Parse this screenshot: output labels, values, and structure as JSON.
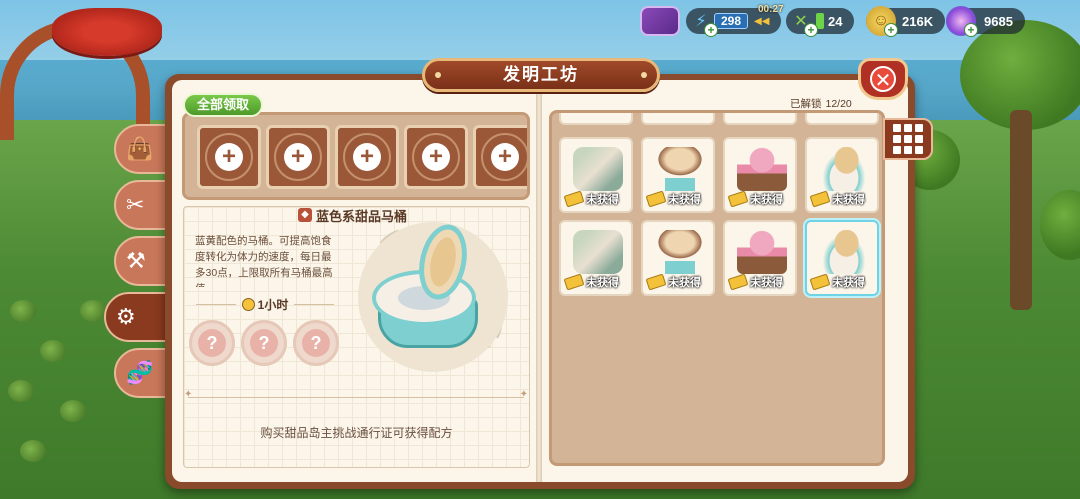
{
  "hud": {
    "energy": "298",
    "timer": "00:27",
    "food": "24",
    "coins": "216K",
    "gems": "9685"
  },
  "window": {
    "title": "发明工坊",
    "close_icon": "close-icon"
  },
  "side_tabs": [
    {
      "icon": "bag-icon"
    },
    {
      "icon": "fork-knife-icon"
    },
    {
      "icon": "anvil-icon"
    },
    {
      "icon": "gear-bulb-icon"
    },
    {
      "icon": "dna-icon"
    }
  ],
  "left_page": {
    "claim_all_label": "全部领取",
    "slots": [
      "+",
      "+",
      "+",
      "+",
      "+"
    ],
    "item_name": "蓝色系甜品马桶",
    "description": "蓝黄配色的马桶。可提高饱食度转化为体力的速度，每日最多30点，上限取所有马桶最高值",
    "craft_time": "1小时",
    "ingredients": [
      "?",
      "?",
      "?"
    ],
    "hint": "购买甜品岛主挑战通行证可获得配方"
  },
  "right_page": {
    "unlocked_label": "已解锁",
    "unlocked_count": "12/20",
    "status_label": "未获得",
    "items": [
      {
        "art": "scroll"
      },
      {
        "art": "mirror"
      },
      {
        "art": "cake"
      },
      {
        "art": "toilet"
      },
      {
        "art": "scroll"
      },
      {
        "art": "mirror"
      },
      {
        "art": "cake"
      },
      {
        "art": "toilet"
      }
    ]
  }
}
